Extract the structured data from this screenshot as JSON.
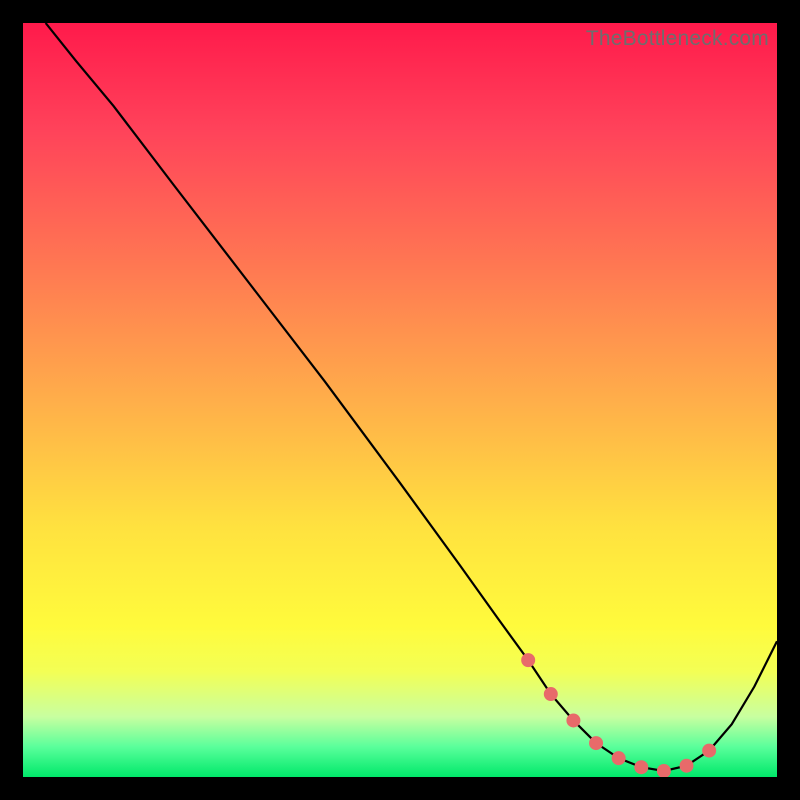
{
  "watermark": "TheBottleneck.com",
  "colors": {
    "curve_stroke": "#000000",
    "marker_fill": "#e86a6a",
    "marker_stroke": "#e86a6a"
  },
  "chart_data": {
    "type": "line",
    "title": "",
    "xlabel": "",
    "ylabel": "",
    "xlim": [
      0,
      100
    ],
    "ylim": [
      0,
      100
    ],
    "series": [
      {
        "name": "curve",
        "x": [
          3,
          7,
          12,
          20,
          30,
          40,
          50,
          58,
          63,
          67,
          70,
          73,
          76,
          79,
          82,
          85,
          88,
          91,
          94,
          97,
          100
        ],
        "y": [
          100,
          95,
          89,
          78.5,
          65.5,
          52.5,
          39,
          28,
          21,
          15.5,
          11,
          7.5,
          4.5,
          2.5,
          1.3,
          0.8,
          1.5,
          3.5,
          7,
          12,
          18
        ]
      }
    ],
    "markers": {
      "series": "curve",
      "x": [
        67,
        70,
        73,
        76,
        79,
        82,
        85,
        88,
        91
      ],
      "y": [
        15.5,
        11,
        7.5,
        4.5,
        2.5,
        1.3,
        0.8,
        1.5,
        3.5
      ],
      "note": "highlighted bottleneck region (near-zero values)"
    }
  }
}
